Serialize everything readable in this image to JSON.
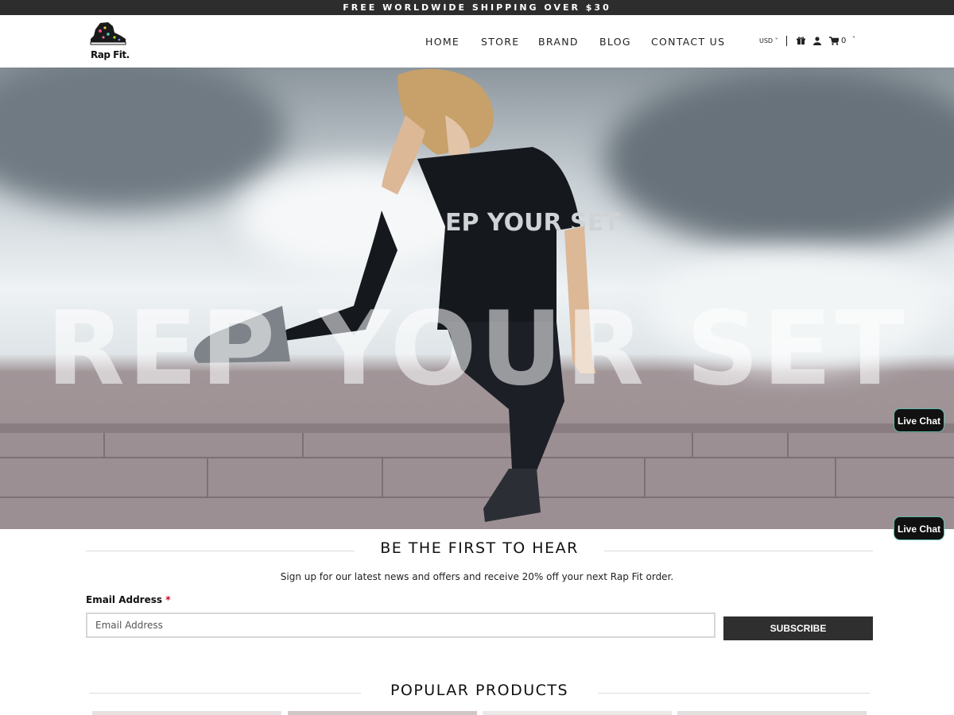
{
  "announcement": "FREE WORLDWIDE SHIPPING OVER $30",
  "brand": {
    "name": "Rap Fit."
  },
  "nav": [
    {
      "label": "HOME"
    },
    {
      "label": "STORE"
    },
    {
      "label": "BRAND"
    },
    {
      "label": "BLOG"
    },
    {
      "label": "CONTACT US"
    }
  ],
  "utilities": {
    "currency": "USD",
    "currency_caret": "˅",
    "gift_icon": "gift-icon",
    "account_icon": "user-icon",
    "cart_icon": "cart-icon",
    "cart_count": "0",
    "cart_caret": "˅"
  },
  "hero": {
    "overlay_text": "REP YOUR SET",
    "shirt_text": "EP YOUR SET"
  },
  "live_chat": [
    {
      "label": "Live Chat"
    },
    {
      "label": "Live Chat"
    }
  ],
  "newsletter": {
    "title": "BE THE FIRST TO HEAR",
    "subtitle": "Sign up for our latest news and offers and receive 20% off your next Rap Fit order.",
    "email_label": "Email Address",
    "required_mark": "*",
    "email_placeholder": "Email Address",
    "email_value": "",
    "button_label": "SUBSCRIBE"
  },
  "popular": {
    "title": "POPULAR PRODUCTS"
  },
  "colors": {
    "announcement_bg": "#2d2d2d",
    "button_bg": "#2f2f2f",
    "required": "#d0021b",
    "live_chat_border": "#5fb8a8"
  }
}
